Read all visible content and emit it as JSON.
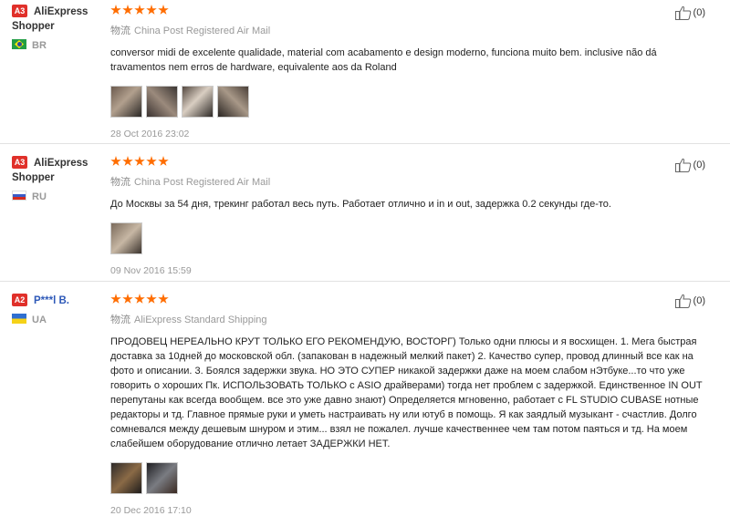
{
  "reviews": [
    {
      "level": "A3",
      "user": "AliExpress Shopper",
      "country": "BR",
      "flag": "flag-br",
      "ship_cn": "物流",
      "shipping": "China Post Registered Air Mail",
      "text": "conversor midi de excelente qualidade, material com acabamento e design moderno, funciona muito bem. inclusive não dá travamentos nem erros de hardware, equivalente aos da Roland",
      "date": "28 Oct 2016 23:02",
      "helpful": "(0)",
      "photo_count": 4
    },
    {
      "level": "A3",
      "user": "AliExpress Shopper",
      "country": "RU",
      "flag": "flag-ru",
      "ship_cn": "物流",
      "shipping": "China Post Registered Air Mail",
      "text": "До Москвы за 54 дня, трекинг работал весь путь. Работает отлично и in и out, задержка 0.2 секунды где-то.",
      "date": "09 Nov 2016 15:59",
      "helpful": "(0)",
      "photo_count": 1
    },
    {
      "level": "A2",
      "user": "P***l B.",
      "country": "UA",
      "flag": "flag-ua",
      "ship_cn": "物流",
      "shipping": "AliExpress Standard Shipping",
      "text": "ПРОДОВЕЦ НЕРЕАЛЬНО КРУТ ТОЛЬКО ЕГО РЕКОМЕНДУЮ, ВОСТОРГ) Только одни плюсы и я восхищен. 1. Мега быстрая доставка за 10дней до московской обл. (запакован в надежный мелкий пакет) 2. Качество супер, провод длинный все как на фото и описании. 3. Боялся задержки звука. НО ЭТО СУПЕР никакой задержки даже на моем слабом нЭтбуке...то что уже говорить о хороших Пк. ИСПОЛЬЗОВАТЬ ТОЛЬКО с ASIO драйверами) тогда нет проблем с задержкой. Единственное IN OUT перепутаны как всегда вообщем. все это уже давно знают) Определяется мгновенно, работает с FL STUDIO CUBASE нотные редакторы и тд. Главное прямые руки и уметь настраивать ну или ютуб в помощь. Я как заядлый музыкант - счастлив. Долго сомневался между дешевым шнуром и этим... взял не пожалел. лучше качественнее чем там потом паяться и тд. На моем слабейшем оборудование отлично летает ЗАДЕРЖКИ НЕТ.",
      "date": "20 Dec 2016 17:10",
      "helpful": "(0)",
      "photo_count": 2
    }
  ]
}
